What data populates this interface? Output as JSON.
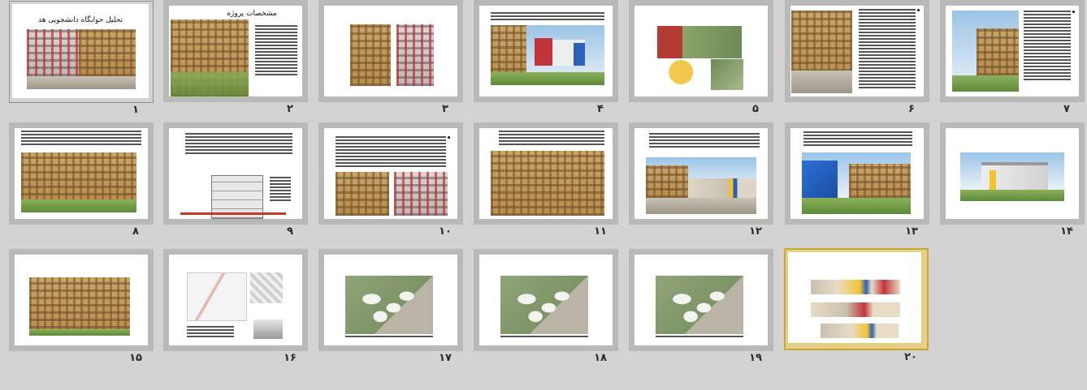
{
  "slides": [
    {
      "number": "۱",
      "title": "تحلیل خوابگاه دانشجویی هد"
    },
    {
      "number": "۲",
      "title": "مشخصات پروژه"
    },
    {
      "number": "۳"
    },
    {
      "number": "۴"
    },
    {
      "number": "۵"
    },
    {
      "number": "۶"
    },
    {
      "number": "۷"
    },
    {
      "number": "۸"
    },
    {
      "number": "۹"
    },
    {
      "number": "۱۰"
    },
    {
      "number": "۱۱"
    },
    {
      "number": "۱۲"
    },
    {
      "number": "۱۳"
    },
    {
      "number": "۱۴"
    },
    {
      "number": "۱۵"
    },
    {
      "number": "۱۶"
    },
    {
      "number": "۱۷"
    },
    {
      "number": "۱۸"
    },
    {
      "number": "۱۹"
    },
    {
      "number": "۲۰"
    }
  ],
  "selected_slide": "۲۰",
  "colors": {
    "background": "#d3d3d3",
    "frame": "#b9b9b9",
    "selected_frame": "#e4cf82",
    "selected_border": "#c7a736"
  }
}
